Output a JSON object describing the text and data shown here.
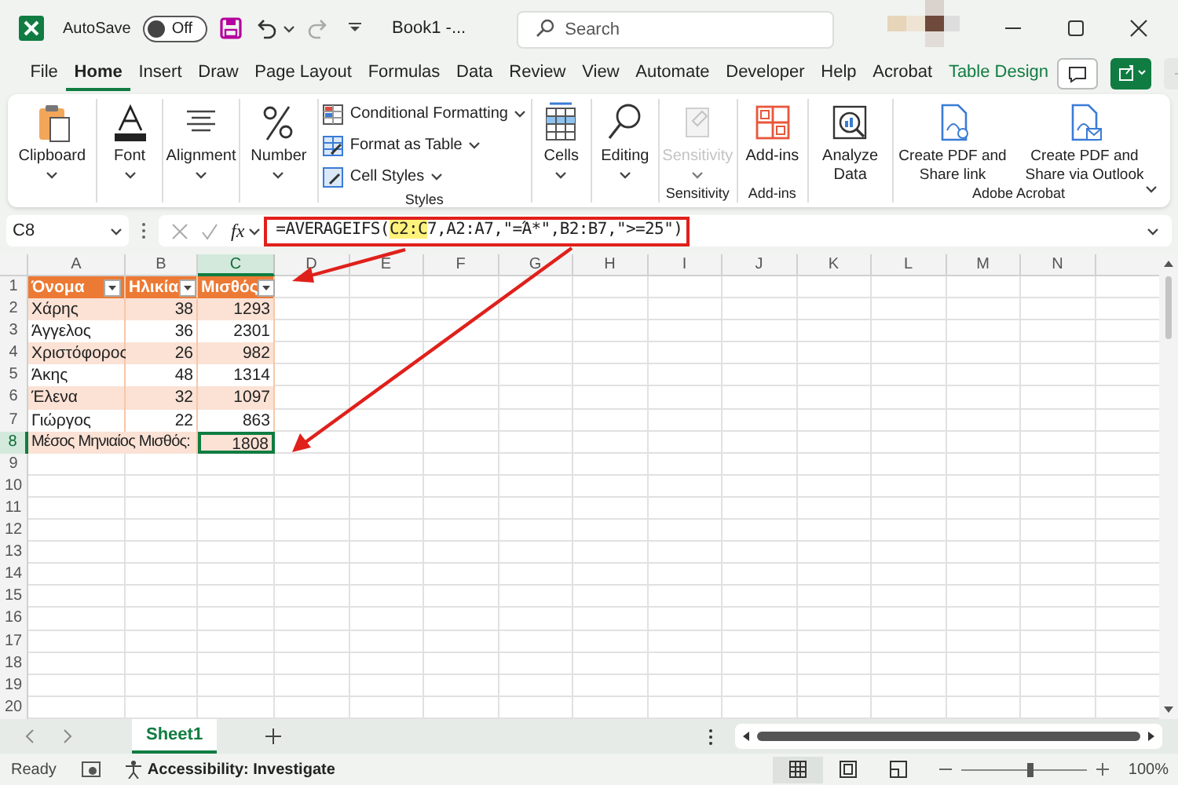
{
  "title_bar": {
    "autosave_label": "AutoSave",
    "autosave_toggle": {
      "label": "Off",
      "on": false
    },
    "document_title": "Book1 -...",
    "search_placeholder": "Search"
  },
  "menu_tabs": [
    {
      "label": "File",
      "selected": false,
      "kind": "normal"
    },
    {
      "label": "Home",
      "selected": true,
      "kind": "normal"
    },
    {
      "label": "Insert",
      "selected": false,
      "kind": "normal"
    },
    {
      "label": "Draw",
      "selected": false,
      "kind": "normal"
    },
    {
      "label": "Page Layout",
      "selected": false,
      "kind": "normal"
    },
    {
      "label": "Formulas",
      "selected": false,
      "kind": "normal"
    },
    {
      "label": "Data",
      "selected": false,
      "kind": "normal"
    },
    {
      "label": "Review",
      "selected": false,
      "kind": "normal"
    },
    {
      "label": "View",
      "selected": false,
      "kind": "normal"
    },
    {
      "label": "Automate",
      "selected": false,
      "kind": "normal"
    },
    {
      "label": "Developer",
      "selected": false,
      "kind": "normal"
    },
    {
      "label": "Help",
      "selected": false,
      "kind": "normal"
    },
    {
      "label": "Acrobat",
      "selected": false,
      "kind": "normal"
    },
    {
      "label": "Table Design",
      "selected": false,
      "kind": "contextual"
    }
  ],
  "ribbon_groups": [
    {
      "buttons": [
        {
          "label": "Clipboard",
          "kind": "large",
          "dropdown": true,
          "disabled": false
        }
      ]
    },
    {
      "buttons": [
        {
          "label": "Font",
          "kind": "large",
          "dropdown": true,
          "disabled": false
        }
      ]
    },
    {
      "buttons": [
        {
          "label": "Alignment",
          "kind": "large",
          "dropdown": true,
          "disabled": false
        }
      ]
    },
    {
      "buttons": [
        {
          "label": "Number",
          "kind": "large",
          "dropdown": true,
          "disabled": false
        }
      ]
    },
    {
      "label": "Styles",
      "buttons": [
        {
          "label": "Conditional Formatting",
          "kind": "small",
          "dropdown": true,
          "disabled": false
        },
        {
          "label": "Format as Table",
          "kind": "small",
          "dropdown": true,
          "disabled": false
        },
        {
          "label": "Cell Styles",
          "kind": "small",
          "dropdown": true,
          "disabled": false
        }
      ]
    },
    {
      "buttons": [
        {
          "label": "Cells",
          "kind": "large",
          "dropdown": true,
          "disabled": false
        }
      ]
    },
    {
      "buttons": [
        {
          "label": "Editing",
          "kind": "large",
          "dropdown": true,
          "disabled": false
        }
      ]
    },
    {
      "label": "Sensitivity",
      "buttons": [
        {
          "label": "Sensitivity",
          "kind": "large",
          "dropdown": true,
          "disabled": true
        }
      ]
    },
    {
      "label": "Add-ins",
      "buttons": [
        {
          "label": "Add-ins",
          "kind": "large",
          "dropdown": false,
          "disabled": false
        }
      ]
    },
    {
      "buttons": [
        {
          "label": "Analyze Data",
          "kind": "large",
          "dropdown": false,
          "disabled": false
        }
      ]
    },
    {
      "label": "Adobe Acrobat",
      "buttons": [
        {
          "label": "Create PDF and Share link",
          "kind": "large",
          "dropdown": false,
          "disabled": false
        },
        {
          "label": "Create PDF and Share via Outlook",
          "kind": "large",
          "dropdown": false,
          "disabled": false
        }
      ]
    }
  ],
  "formula_bar": {
    "name_box": "C8",
    "function_label": "fx",
    "formula_parts": [
      {
        "text": "=AVERAGEIFS(",
        "highlighted": false
      },
      {
        "text": "C2:C",
        "highlighted": true
      },
      {
        "text": "7,A2:A7,\"=Ά*\",B2:B7,\">=25\")",
        "highlighted": false
      }
    ]
  },
  "sheet": {
    "columns": [
      {
        "label": "A",
        "selected": false
      },
      {
        "label": "B",
        "selected": false
      },
      {
        "label": "C",
        "selected": true
      },
      {
        "label": "D",
        "selected": false
      },
      {
        "label": "E",
        "selected": false
      },
      {
        "label": "F",
        "selected": false
      },
      {
        "label": "G",
        "selected": false
      },
      {
        "label": "H",
        "selected": false
      },
      {
        "label": "I",
        "selected": false
      },
      {
        "label": "J",
        "selected": false
      },
      {
        "label": "K",
        "selected": false
      },
      {
        "label": "L",
        "selected": false
      },
      {
        "label": "M",
        "selected": false
      },
      {
        "label": "N",
        "selected": false
      }
    ],
    "rows": [
      {
        "label": "1",
        "selected": false
      },
      {
        "label": "2",
        "selected": false
      },
      {
        "label": "3",
        "selected": false
      },
      {
        "label": "4",
        "selected": false
      },
      {
        "label": "5",
        "selected": false
      },
      {
        "label": "6",
        "selected": false
      },
      {
        "label": "7",
        "selected": false
      },
      {
        "label": "8",
        "selected": true
      },
      {
        "label": "9",
        "selected": false
      },
      {
        "label": "10",
        "selected": false
      },
      {
        "label": "11",
        "selected": false
      },
      {
        "label": "12",
        "selected": false
      },
      {
        "label": "13",
        "selected": false
      },
      {
        "label": "14",
        "selected": false
      },
      {
        "label": "15",
        "selected": false
      },
      {
        "label": "16",
        "selected": false
      },
      {
        "label": "17",
        "selected": false
      },
      {
        "label": "18",
        "selected": false
      },
      {
        "label": "19",
        "selected": false
      },
      {
        "label": "20",
        "selected": false
      }
    ]
  },
  "table": {
    "header": [
      "Όνομα",
      "Ηλικία",
      "Μισθός"
    ],
    "rows": [
      [
        "Χάρης",
        "38",
        "1293"
      ],
      [
        "Άγγελος",
        "36",
        "2301"
      ],
      [
        "Χριστόφορος",
        "26",
        "982"
      ],
      [
        "Άκης",
        "48",
        "1314"
      ],
      [
        "Έλενα",
        "32",
        "1097"
      ],
      [
        "Γιώργος",
        "22",
        "863"
      ]
    ],
    "total": {
      "label": "Μέσος Μηνιαίος Μισθός:",
      "value": "1808",
      "selected": true
    }
  },
  "sheet_tabs": [
    {
      "label": "Sheet1",
      "selected": true
    }
  ],
  "status_bar": {
    "status": "Ready",
    "accessibility": "Accessibility: Investigate",
    "views": [
      {
        "selected": true
      },
      {
        "selected": false
      },
      {
        "selected": false
      }
    ],
    "zoom_slider": {
      "level": 0.55
    },
    "zoom_label": "100%"
  }
}
